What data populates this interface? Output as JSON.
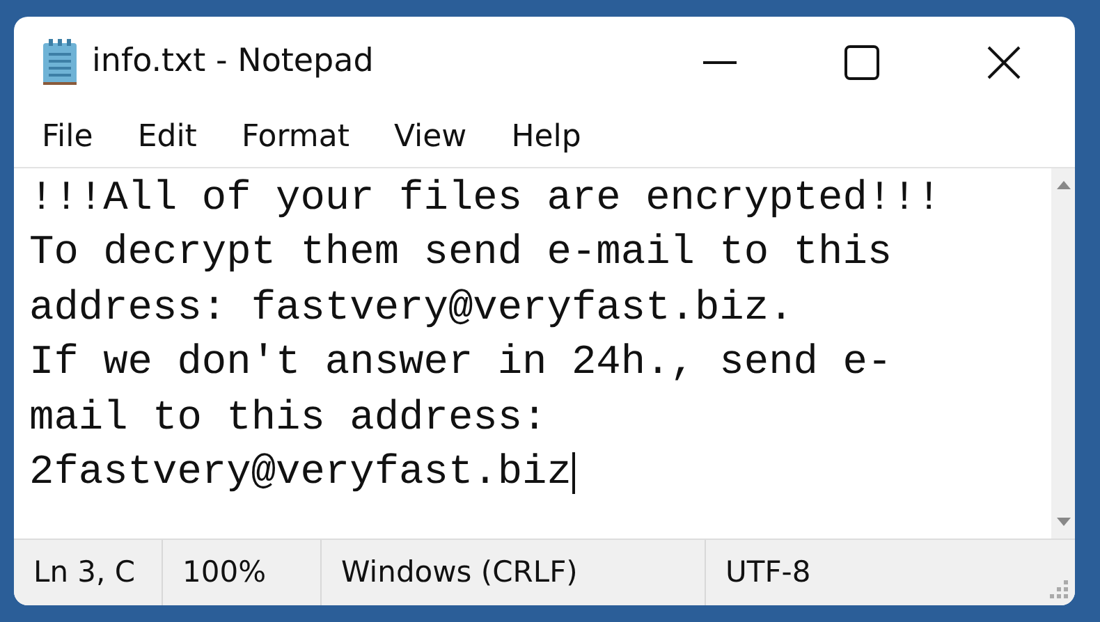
{
  "window": {
    "title": "info.txt - Notepad"
  },
  "menu": [
    "File",
    "Edit",
    "Format",
    "View",
    "Help"
  ],
  "lines": [
    "!!!All of your files are encrypted!!!",
    "To decrypt them send e-mail to this",
    "address: fastvery@veryfast.biz.",
    "If we don't answer in 24h., send e-",
    "mail to this address:",
    "2fastvery@veryfast.biz"
  ],
  "status_bar": [
    "Ln 3, C",
    "100%",
    "Windows (CRLF)",
    "UTF-8"
  ]
}
